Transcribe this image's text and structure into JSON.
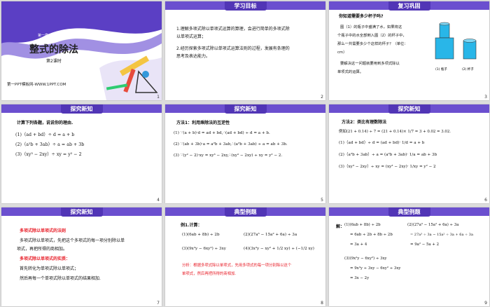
{
  "slides": [
    {
      "page": "1",
      "chapter": "第一章　整式的乘除",
      "title": "整式的除法",
      "subtitle": "第2课时",
      "site": "第一PPT模板网-WWW.1PPT.COM"
    },
    {
      "page": "2",
      "heading": "学习目标",
      "lines": [
        "1.理解多项式除以单项式运算的算理，会进行简单的多项式除",
        "以单项式运算；",
        "2.经历探索多项式除以单项式运算法则的过程，发展有条理的",
        "思考及表达能力。"
      ]
    },
    {
      "page": "3",
      "heading": "复习巩固",
      "lines": [
        "你知道需要多少杯子吗?",
        "图（1）的瓶子中盛满了水，如果将这",
        "个瓶子中的水全部倒入图（2）的杯子中，",
        "那么一共需要多少个这样的杯子？（单位：",
        "cm）",
        "要解决这一问题就要用到多项式除以",
        "单项式的运算。"
      ],
      "figure_labels": [
        "(1) 瓶子",
        "(2) 杯子"
      ]
    },
    {
      "page": "4",
      "heading": "探究新知",
      "intro": "计算下列各题，说说你的理由.",
      "lines": [
        "(1)（ad + bd）÷ d = a + b",
        "(2)（a²b + 3ab）÷ a = ab + 3b",
        "(3)（xy³ − 2xy）÷ xy = y² − 2"
      ]
    },
    {
      "page": "5",
      "heading": "探究新知",
      "intro": "方法1：利用乘除法的互逆性",
      "lines": [
        "(1) ∵(a + b)·d = ad + bd,∴(ad + bd) ÷ d = a + b.",
        "(2) ∵(ab + 3b)·a = a²b + 3ab,∴(a²b + 3ab) ÷ a = ab + 3b.",
        "(3) ∵(y² − 2)·xy = xy³ − 2xy,∴(xy³ − 2xy) ÷ xy = y² − 2."
      ]
    },
    {
      "page": "6",
      "heading": "探究新知",
      "intro": "方法2：类比有理数除法",
      "example": "例如(21 + 0.14) ÷ 7 = (21 + 0.14)× 1/7 = 3 + 0.02 = 3.02.",
      "lines": [
        "(1)（ad + bd）÷ d = (ad + bd)· 1/d = a + b",
        "(2)（a²b + 3ab）÷ a = (a²b + 3ab)· 1/a = ab + 3b",
        "(3)（xy³ − 2xy）÷ xy = (xy³ − 2xy)· 1/xy = y² − 2"
      ]
    },
    {
      "page": "7",
      "heading": "探究新知",
      "rule_title": "多项式除以单项式的法则",
      "rule_lines": [
        "多项式除以单项式，先把这个多项式的每一项分别除以单",
        "项式，再把所得的商相加。"
      ],
      "essence_title": "多项式除以单项式的实质：",
      "essence_lines": [
        "首先转化为单项式除以单项式；",
        "然后再每一个单项式除以单项式的结果相加."
      ]
    },
    {
      "page": "8",
      "heading": "典型例题",
      "example_title": "例1.计算：",
      "problems": [
        "(1)(6ab + 8b) ÷ 2b",
        "(2)(27a³ − 15a² + 6a) ÷ 3a",
        "(3)(9x²y − 6xy²) ÷ 3xy",
        "(4)(3x²y − xy² + 1/2 xy) ÷ (−1/2 xy)"
      ],
      "analysis": [
        "分析：根据多项式除以单项式，先用多项式的每一项分别除以这个",
        "单项式，然后再把所得的商相加."
      ]
    },
    {
      "page": "9",
      "heading": "典型例题",
      "answer_label": "解：",
      "col1": [
        "(1)(6ab + 8b) ÷ 2b",
        "= 6ab ÷ 2b + 8b ÷ 2b",
        "= 3a + 4"
      ],
      "col2": [
        "(2)(27a³ − 15a² + 6a) ÷ 3a",
        "= 27a³ ÷ 3a − 15a² ÷ 3a + 6a ÷ 3a",
        "= 9a² − 5a + 2"
      ],
      "col3": [
        "(3)(9x²y − 6xy²) ÷ 3xy",
        "= 9x²y ÷ 3xy − 6xy² ÷ 3xy",
        "= 3x − 2y"
      ]
    }
  ],
  "colors": {
    "header": "#6b4fcf",
    "header_tab": "#5135b6",
    "highlight": "#e8202a"
  }
}
